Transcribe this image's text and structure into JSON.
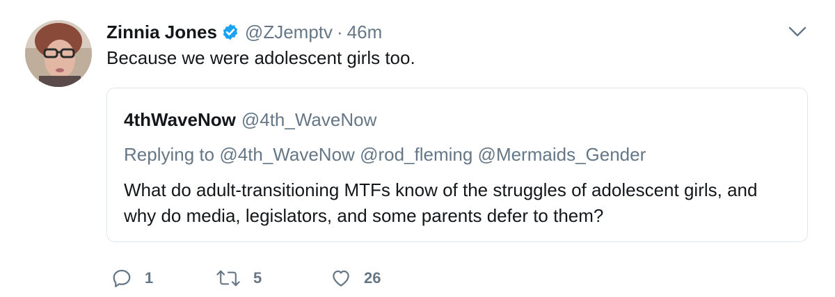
{
  "tweet": {
    "author_name": "Zinnia Jones",
    "author_handle": "@ZJemptv",
    "separator": "·",
    "time": "46m",
    "text": "Because we were adolescent girls too.",
    "verified": true,
    "icons": {
      "avatar": "profile-photo",
      "verified": "verified-badge-icon",
      "menu": "chevron-down-icon"
    }
  },
  "quote": {
    "author_name": "4thWaveNow",
    "author_handle": "@4th_WaveNow",
    "replying_label": "Replying to",
    "mentions": [
      "@4th_WaveNow",
      "@rod_fleming",
      "@Mermaids_Gender"
    ],
    "text": "What do adult-transitioning MTFs know of the struggles of adolescent girls, and why do media, legislators, and some parents defer to them?"
  },
  "actions": {
    "reply_count": "1",
    "retweet_count": "5",
    "like_count": "26",
    "icons": {
      "reply": "reply-icon",
      "retweet": "retweet-icon",
      "like": "heart-icon"
    }
  },
  "colors": {
    "text": "#14171a",
    "secondary": "#657786",
    "border": "#e1e8ed",
    "verified": "#1da1f2"
  }
}
